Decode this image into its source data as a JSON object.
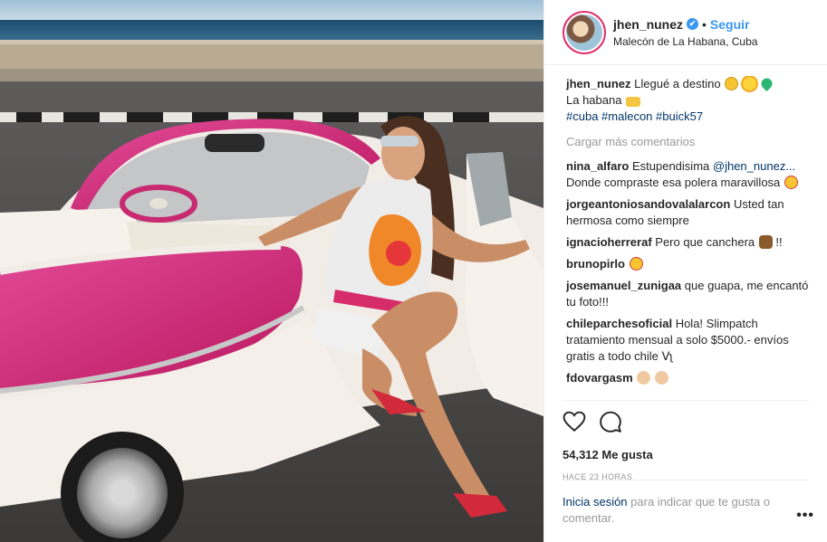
{
  "post": {
    "username": "jhen_nunez",
    "verified_mark": "✔",
    "separator": "•",
    "follow_label": "Seguir",
    "location": "Malecón de La Habana, Cuba"
  },
  "caption": {
    "username": "jhen_nunez",
    "line1": "Llegué a destino",
    "line2": "La habana",
    "hashtags": [
      "#cuba",
      "#malecon",
      "#buick57"
    ]
  },
  "load_more": "Cargar más comentarios",
  "comments": [
    {
      "user": "nina_alfaro",
      "text": "Estupendisima",
      "mention": "@jhen_nunez...",
      "text2": "Donde compraste esa polera maravillosa"
    },
    {
      "user": "jorgeantoniosandovalalarcon",
      "text": "Usted tan hermosa como siempre"
    },
    {
      "user": "ignacioherreraf",
      "text": "Pero que canchera",
      "text2": "!!"
    },
    {
      "user": "brunopirlo",
      "text": ""
    },
    {
      "user": "josemanuel_zunigaa",
      "text": "que guapa, me encantó tu foto!!!"
    },
    {
      "user": "chileparchesoficial",
      "text": "Hola! Slimpatch tratamiento mensual a solo $5000.- envíos gratis a todo chile ⴸʅ"
    },
    {
      "user": "fdovargasm",
      "text": ""
    }
  ],
  "likes": "54,312 Me gusta",
  "time": "HACE 23 HORAS",
  "login": {
    "link": "Inicia sesión",
    "text": "para indicar que te gusta o comentar."
  },
  "more_label": "•••",
  "icons": {
    "like": "heart-icon",
    "comment": "comment-bubble-icon",
    "verified": "verified-badge-icon",
    "options": "more-options-icon"
  },
  "colors": {
    "link_blue": "#3897f0",
    "hashtag": "#003569",
    "muted": "#999999",
    "car_pink": "#d6317e"
  }
}
